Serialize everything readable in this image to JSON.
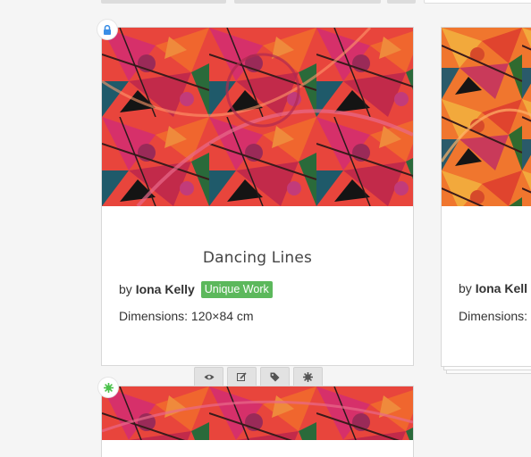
{
  "card1": {
    "title": "Dancing Lines",
    "by_prefix": "by",
    "artist": "Iona Kelly",
    "tag": "Unique Work",
    "dimensions": "Dimensions: 120×84 cm",
    "status_icon": "lock-icon",
    "actions": [
      "eye-icon",
      "edit-icon",
      "tag-icon",
      "gear-icon"
    ]
  },
  "card2": {
    "by_prefix": "by",
    "artist": "Iona Kell",
    "dimensions": "Dimensions:"
  },
  "card3": {
    "status_icon": "gear-icon"
  },
  "colors": {
    "tag_green": "#5cb85c",
    "lock_blue": "#3a8ee6",
    "status_green": "#4cc24c"
  }
}
